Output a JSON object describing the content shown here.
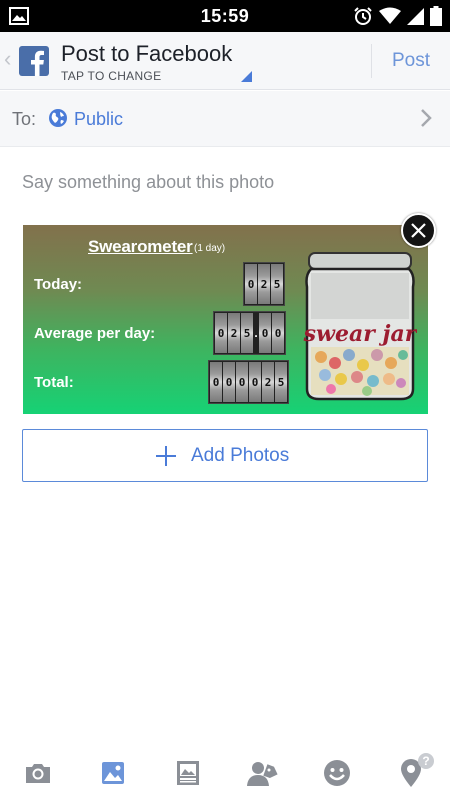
{
  "status_bar": {
    "time": "15:59",
    "icons": [
      "gallery-icon",
      "alarm-icon",
      "wifi-icon",
      "signal-icon",
      "battery-icon"
    ]
  },
  "header": {
    "title": "Post to Facebook",
    "subtitle": "TAP TO CHANGE",
    "post_label": "Post",
    "logo": "facebook-icon"
  },
  "audience": {
    "label": "To:",
    "value": "Public",
    "icon": "globe-icon"
  },
  "composer": {
    "placeholder": "Say something about this photo"
  },
  "attachment": {
    "title": "Swearometer",
    "period": "(1 day)",
    "rows": [
      {
        "label": "Today:",
        "digits": "025"
      },
      {
        "label": "Average per day:",
        "digits": "025.00"
      },
      {
        "label": "Total:",
        "digits": "000025"
      }
    ],
    "jar_label": "swear jar"
  },
  "add_photos": {
    "label": "Add Photos"
  },
  "toolbar": {
    "items": [
      "camera-icon",
      "photo-icon",
      "album-icon",
      "tag-people-icon",
      "emoji-icon",
      "location-icon"
    ],
    "help": "?"
  },
  "colors": {
    "accent": "#4a7bd8",
    "header_bg": "#f6f7f9",
    "toolbar_active": "#6d95d9",
    "toolbar_inactive": "#8b8f96"
  }
}
